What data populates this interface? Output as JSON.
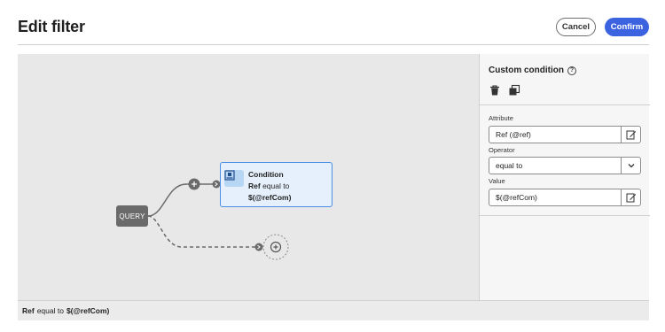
{
  "header": {
    "title": "Edit filter",
    "cancel_label": "Cancel",
    "confirm_label": "Confirm"
  },
  "canvas": {
    "query_label": "QUERY",
    "condition": {
      "title": "Condition",
      "attribute": "Ref",
      "operator": "equal to",
      "value": "$(@refCom)"
    }
  },
  "panel": {
    "title": "Custom condition",
    "attribute_label": "Attribute",
    "attribute_value": "Ref (@ref)",
    "operator_label": "Operator",
    "operator_value": "equal to",
    "value_label": "Value",
    "value_value": "$(@refCom)"
  },
  "footer": {
    "attribute": "Ref",
    "operator": "equal to",
    "value": "$(@refCom)"
  },
  "colors": {
    "accent": "#3b63e0",
    "node_border": "#4b8ee6",
    "node_fill": "#e6f0fc",
    "query_node": "#6a6a6a"
  },
  "icons": [
    "help-icon",
    "delete-icon",
    "copy-icon",
    "edit-icon",
    "chevron-down-icon",
    "add-icon",
    "connector-arrow-icon",
    "condition-icon"
  ]
}
